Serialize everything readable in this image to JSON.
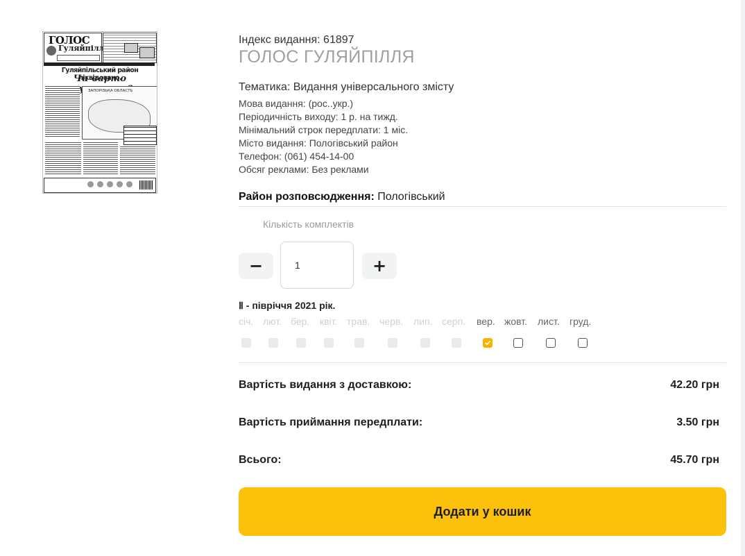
{
  "cover": {
    "logo_line1": "ГОЛОС",
    "logo_line2": "Гуляйпілля",
    "headline": "Гуляйпільський район ліквідовано.",
    "subheadline": "Чи варто журитися?",
    "map_label": "ЗАПОРІЗЬКА ОБЛАСТЬ"
  },
  "publication": {
    "index": "Індекс видання: 61897",
    "title": "ГОЛОС ГУЛЯЙПІЛЛЯ",
    "topic": "Тематика: Видання універсального змісту",
    "meta": [
      "Мова видання: (рос..укр.)",
      "Періодичність виходу: 1 р. на тижд.",
      "Мінімальний строк передплати: 1 міс.",
      "Місто видання: Пологівський район",
      "Телефон: (061) 454-14-00",
      "Обсяг реклами: Без реклами"
    ],
    "district_label": "Район розповсюдження:",
    "district_value": " Пологівський"
  },
  "quantity": {
    "label": "Кількість комплектів",
    "value": "1",
    "minus": "−",
    "plus": "+"
  },
  "period": {
    "title": "Ⅱ - півріччя 2021 рік.",
    "months": [
      {
        "label": "січ.",
        "enabled": false,
        "checked": false
      },
      {
        "label": "лют.",
        "enabled": false,
        "checked": false
      },
      {
        "label": "бер.",
        "enabled": false,
        "checked": false
      },
      {
        "label": "квіт.",
        "enabled": false,
        "checked": false
      },
      {
        "label": "трав.",
        "enabled": false,
        "checked": false
      },
      {
        "label": "черв.",
        "enabled": false,
        "checked": false
      },
      {
        "label": "лип.",
        "enabled": false,
        "checked": false
      },
      {
        "label": "серп.",
        "enabled": false,
        "checked": false
      },
      {
        "label": "вер.",
        "enabled": true,
        "checked": true
      },
      {
        "label": "жовт.",
        "enabled": true,
        "checked": false
      },
      {
        "label": "лист.",
        "enabled": true,
        "checked": false
      },
      {
        "label": "груд.",
        "enabled": true,
        "checked": false
      }
    ]
  },
  "prices": {
    "delivery_label": "Вартість видання з доставкою:",
    "delivery_value": "42.20 грн",
    "fee_label": "Вартість приймання передплати:",
    "fee_value": "3.50 грн",
    "total_label": "Всього:",
    "total_value": "45.70 грн"
  },
  "cart_button": "Додати у кошик",
  "colors": {
    "accent": "#fcc10b",
    "checkbox_checked": "#f7b500",
    "title_gray": "#a0a0a0"
  }
}
